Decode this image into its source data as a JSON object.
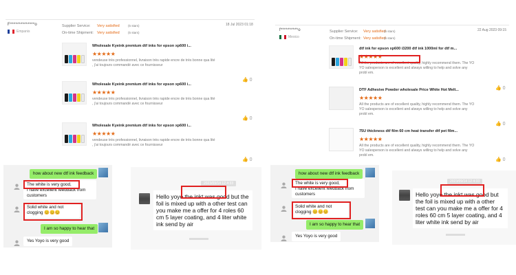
{
  "left_review": {
    "reviewer": "F**************o",
    "country": "Empanis",
    "labels": [
      "Supplier Service:",
      "On-time Shipment:"
    ],
    "values": [
      "Very satisfied",
      "Very satisfied"
    ],
    "star_counts": [
      "(5 stars)",
      "(5 stars)"
    ],
    "date": "18 Jul 2023 01:18",
    "items": [
      {
        "name": "Wholesale Kyeink premium dtf inks for epson xp600 i...",
        "stars": "★★★★★",
        "comment": "vendeuse très professionnel, livraison très rapide encre de très bonne qua lité , j'ai toujours commandé avec ce fournisseur",
        "likes": "0"
      },
      {
        "name": "Wholesale Kyeink premium dtf inks for epson xp600 i...",
        "stars": "★★★★★",
        "comment": "vendeuse très professionnel, livraison très rapide encre de très bonne qua lité , j'ai toujours commandé avec ce fournisseur",
        "likes": "0"
      },
      {
        "name": "Wholesale Kyeink premium dtf inks for epson xp600 i...",
        "stars": "★★★★★",
        "comment": "vendeuse très professionnel, livraison très rapide encre de très bonne qua lité , j'ai toujours commandé avec ce fournisseur",
        "likes": "0"
      }
    ]
  },
  "right_review": {
    "reviewer": "f**********o",
    "country": "Mexico",
    "labels": [
      "Supplier Service:",
      "On-time Shipment:"
    ],
    "values": [
      "Very satisfied",
      "Very satisfied"
    ],
    "star_counts": [
      "(5 stars)",
      "(5 stars)"
    ],
    "date": "22 Aug 2023 09:15",
    "items": [
      {
        "name": "dtf ink for epson xp600 i3200 dtf ink 1000ml for dtf m...",
        "stars": "★★★★★",
        "comment": "All the products are of excellent quality, highly recommend them. The YO YO salesperson is excellent and always willing to help and solve any probl em.",
        "likes": "0"
      },
      {
        "name": "DTF Adhesive Powder wholesale Price White Hot Melt...",
        "stars": "★★★★★",
        "comment": "All the products are of excellent quality, highly recommend them. The YO YO salesperson is excellent and always willing to help and solve any probl em.",
        "likes": "0"
      },
      {
        "name": "75U thickness dtf film 60 cm heat transfer dtf pet film...",
        "stars": "★★★★★",
        "comment": "All the products are of excellent quality, highly recommend them. The YO YO salesperson is excellent and always willing to help and solve any probl em.",
        "likes": "0"
      }
    ]
  },
  "chats": [
    {
      "q": "how about new dtf ink feedback",
      "r1": "The white is very good,",
      "r1b": "I have excellent feedback from customers",
      "r2": "Solid white and not clogging 😊😊😊",
      "reply": "I am so happy to hear that",
      "r3": "Yes Yoyo is very good"
    },
    {
      "q": "how about new dtf ink feedback",
      "r1": "The white is very good,",
      "r1b": "I have excellent feedback from customers",
      "r2": "Solid white and not clogging 😊😊😊",
      "reply": "I am so happy to hear that",
      "r3": "Yes Yoyo is very good"
    }
  ],
  "messages": [
    {
      "timestamp": "2023/09/14 12 4:33",
      "text": "Hello yoyo the inkt was good but the foil is mixed up with a other test can you make me a offer for 4 roles 60 cm 5 layer coating,  and 4 liter white ink send by air"
    },
    {
      "timestamp": "2023/09/14 12 4:33",
      "text": "Hello yoyo the inkt was good but the foil is mixed up with a other test can you make me a offer for 4 roles 60 cm 5 layer coating,  and 4 liter white ink send by air"
    }
  ],
  "colors": {
    "accent": "#e36a16",
    "highlight": "#e02020",
    "wechat_green": "#95ec69"
  },
  "icons": {
    "like": "thumbs-up-icon",
    "user": "user-icon"
  }
}
